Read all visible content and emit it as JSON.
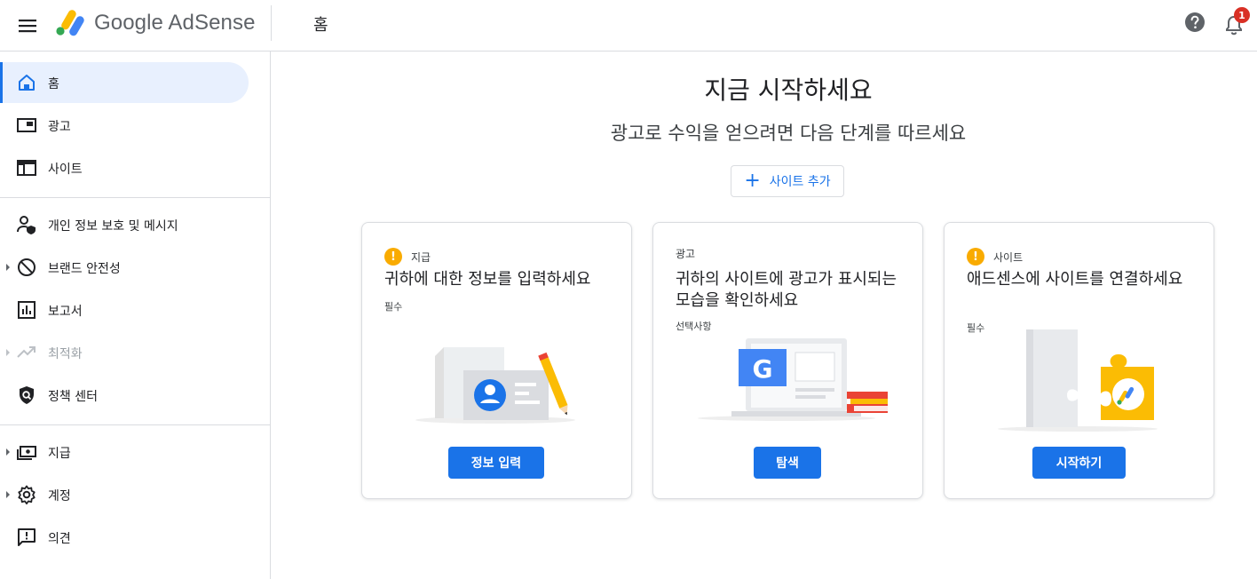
{
  "app": {
    "logo_text": "Google AdSense",
    "page_title": "홈",
    "notification_count": "1"
  },
  "sidebar": {
    "items": [
      {
        "label": "홈",
        "icon": "home-icon"
      },
      {
        "label": "광고",
        "icon": "ads-icon"
      },
      {
        "label": "사이트",
        "icon": "sites-icon"
      },
      {
        "label": "개인 정보 보호 및 메시지",
        "icon": "privacy-icon"
      },
      {
        "label": "브랜드 안전성",
        "icon": "block-icon"
      },
      {
        "label": "보고서",
        "icon": "reports-icon"
      },
      {
        "label": "최적화",
        "icon": "trending-icon"
      },
      {
        "label": "정책 센터",
        "icon": "policy-icon"
      },
      {
        "label": "지급",
        "icon": "payments-icon"
      },
      {
        "label": "계정",
        "icon": "gear-icon"
      },
      {
        "label": "의견",
        "icon": "feedback-icon"
      }
    ]
  },
  "main": {
    "headline": "지금 시작하세요",
    "subhead": "광고로 수익을 얻으려면 다음 단계를 따르세요",
    "add_site_label": "사이트 추가",
    "cards": [
      {
        "category": "지급",
        "title": "귀하에 대한 정보를 입력하세요",
        "status": "필수",
        "button": "정보 입력"
      },
      {
        "category": "광고",
        "title": "귀하의 사이트에 광고가 표시되는 모습을 확인하세요",
        "status": "선택사항",
        "button": "탐색"
      },
      {
        "category": "사이트",
        "title": "애드센스에 사이트를 연결하세요",
        "status": "필수",
        "button": "시작하기"
      }
    ]
  },
  "colors": {
    "accent": "#1a73e8",
    "warning": "#f9ab00",
    "badge": "#d93025",
    "active_bg": "#e8f0fe"
  }
}
